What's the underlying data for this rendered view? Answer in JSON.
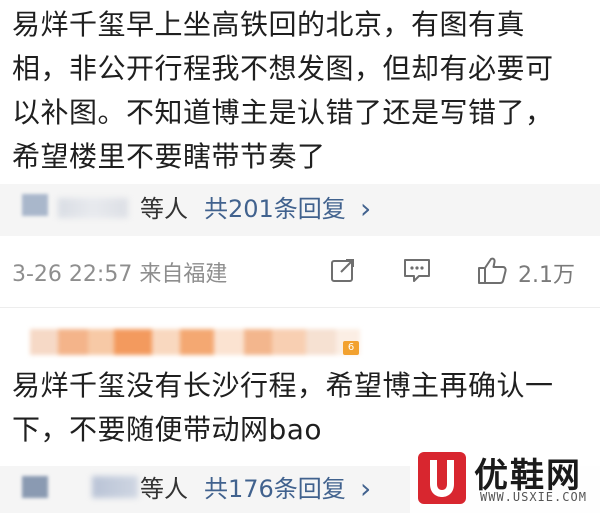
{
  "comments": [
    {
      "text_lines": [
        "易烊千玺早上坐高铁回的北京，有图有真",
        "相，非公开行程我不想发图，但却有必要可",
        "以补图。不知道博主是认错了还是写错了，",
        "希望楼里不要瞎带节奏了"
      ],
      "replies": {
        "deng": "等人",
        "count_label": "共201条回复",
        "chevron": "›"
      },
      "meta": {
        "time_source": "3-26 22:57 来自福建",
        "likes": "2.1万"
      }
    },
    {
      "text_lines": [
        "易烊千玺没有长沙行程，希望博主再确认一",
        "下，不要随便带动网bao"
      ],
      "replies": {
        "deng": "等人",
        "count_label": "共176条回复",
        "chevron": "›"
      },
      "level_badge": "6"
    }
  ],
  "icons": {
    "share": "share-icon",
    "comment": "comment-icon",
    "like": "thumbs-up-icon"
  },
  "watermark": {
    "brand": "优鞋网",
    "site": "WWW.USXIE.COM",
    "logo_color": "#d8262f"
  },
  "colors": {
    "link_blue": "#41628e",
    "meta_gray": "#8e8e8e",
    "reply_bg": "#f5f5f5"
  }
}
